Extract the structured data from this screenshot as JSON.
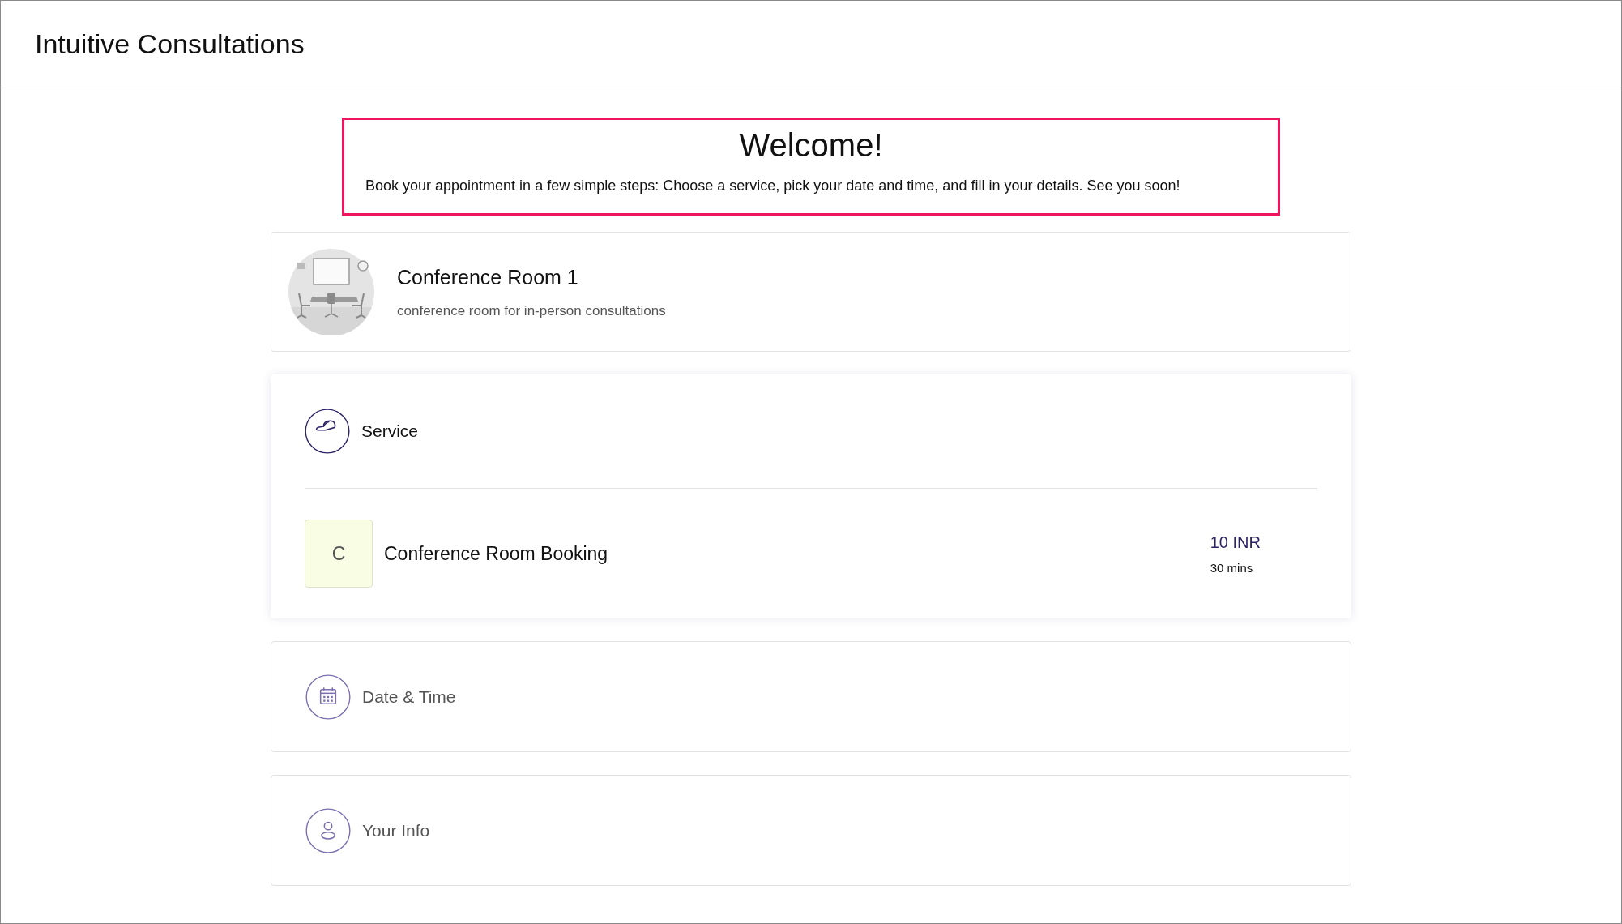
{
  "header": {
    "title": "Intuitive Consultations"
  },
  "welcome": {
    "title": "Welcome!",
    "text": "Book your appointment in a few simple steps: Choose a service, pick your date and time, and fill in your details. See you soon!"
  },
  "resource": {
    "name": "Conference Room 1",
    "description": "conference room for in-person consultations"
  },
  "steps": [
    {
      "kind": "service",
      "label": "Service",
      "expanded": true,
      "items": [
        {
          "initial": "C",
          "name": "Conference Room Booking",
          "price": "10 INR",
          "duration": "30 mins"
        }
      ]
    },
    {
      "kind": "datetime",
      "label": "Date & Time",
      "expanded": false
    },
    {
      "kind": "info",
      "label": "Your Info",
      "expanded": false
    }
  ]
}
